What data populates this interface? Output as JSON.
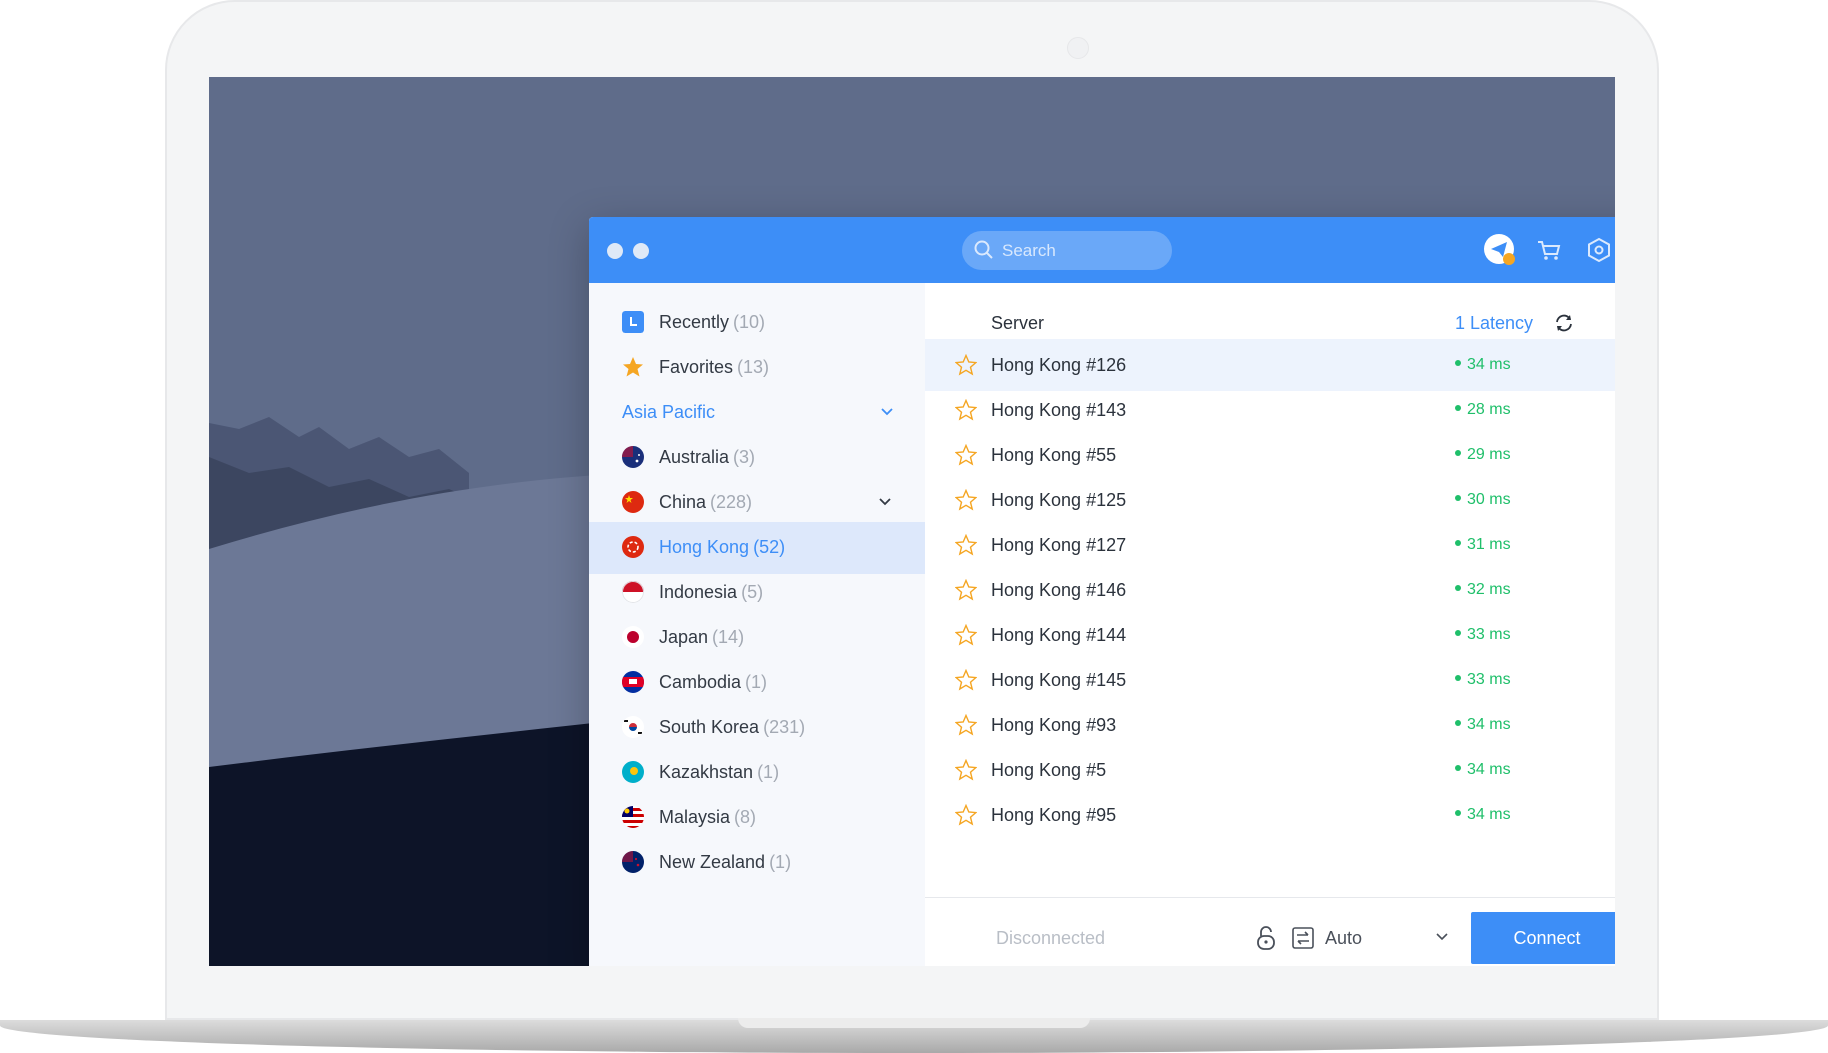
{
  "search": {
    "placeholder": "Search"
  },
  "toolbar": {
    "icons": [
      "paper-plane-icon",
      "cart-icon",
      "settings-hex-icon"
    ]
  },
  "sidebar": {
    "recently": {
      "label": "Recently",
      "count": "(10)"
    },
    "favorites": {
      "label": "Favorites",
      "count": "(13)"
    },
    "region": "Asia Pacific",
    "countries": [
      {
        "label": "Australia",
        "count": "(3)"
      },
      {
        "label": "China",
        "count": "(228)"
      },
      {
        "label": "Hong Kong",
        "count": "(52)"
      },
      {
        "label": "Indonesia",
        "count": "(5)"
      },
      {
        "label": "Japan",
        "count": "(14)"
      },
      {
        "label": "Cambodia",
        "count": "(1)"
      },
      {
        "label": "South Korea",
        "count": "(231)"
      },
      {
        "label": "Kazakhstan",
        "count": "(1)"
      },
      {
        "label": "Malaysia",
        "count": "(8)"
      },
      {
        "label": "New Zealand",
        "count": "(1)"
      }
    ]
  },
  "list": {
    "server_header": "Server",
    "latency_header": "1 Latency",
    "rows": [
      {
        "name": "Hong Kong #126",
        "latency": "34 ms"
      },
      {
        "name": "Hong Kong #143",
        "latency": "28 ms"
      },
      {
        "name": "Hong Kong #55",
        "latency": "29 ms"
      },
      {
        "name": "Hong Kong #125",
        "latency": "30 ms"
      },
      {
        "name": "Hong Kong #127",
        "latency": "31 ms"
      },
      {
        "name": "Hong Kong #146",
        "latency": "32 ms"
      },
      {
        "name": "Hong Kong #144",
        "latency": "33 ms"
      },
      {
        "name": "Hong Kong #145",
        "latency": "33 ms"
      },
      {
        "name": "Hong Kong #93",
        "latency": "34 ms"
      },
      {
        "name": "Hong Kong #5",
        "latency": "34 ms"
      },
      {
        "name": "Hong Kong #95",
        "latency": "34 ms"
      }
    ]
  },
  "footer": {
    "status": "Disconnected",
    "protocol": "Auto",
    "connect_label": "Connect"
  },
  "colors": {
    "accent": "#3d8ef7",
    "latency_good": "#1fbf6a",
    "favorite_star": "#f5a623"
  }
}
